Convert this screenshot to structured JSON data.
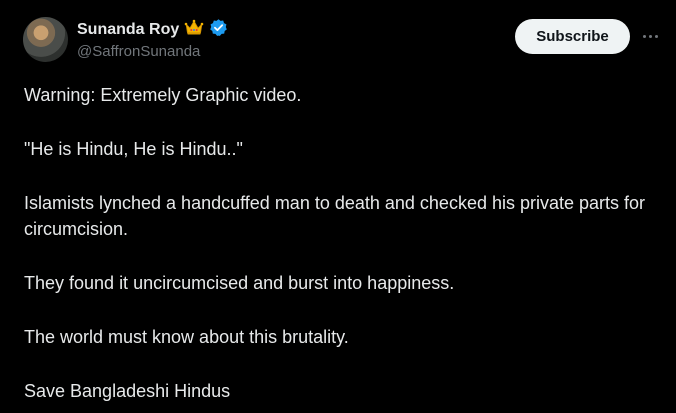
{
  "author": {
    "display_name": "Sunanda Roy",
    "handle": "@SaffronSunanda",
    "badge_icon": "crown-icon",
    "verified_icon": "verified-badge-icon"
  },
  "actions": {
    "subscribe_label": "Subscribe",
    "more_icon": "more-options-icon"
  },
  "post": {
    "paragraphs": [
      "Warning: Extremely Graphic video.",
      "\"He is Hindu, He is Hindu..\"",
      "Islamists lynched a handcuffed man to death and checked his private parts for circumcision.",
      "They found it uncircumcised and burst into happiness.",
      "The world must know about this brutality.",
      "Save Bangladeshi Hindus"
    ]
  },
  "colors": {
    "background": "#000000",
    "text": "#e7e9ea",
    "muted": "#71767b",
    "verified": "#1d9bf0",
    "crown": "#f4b400"
  }
}
